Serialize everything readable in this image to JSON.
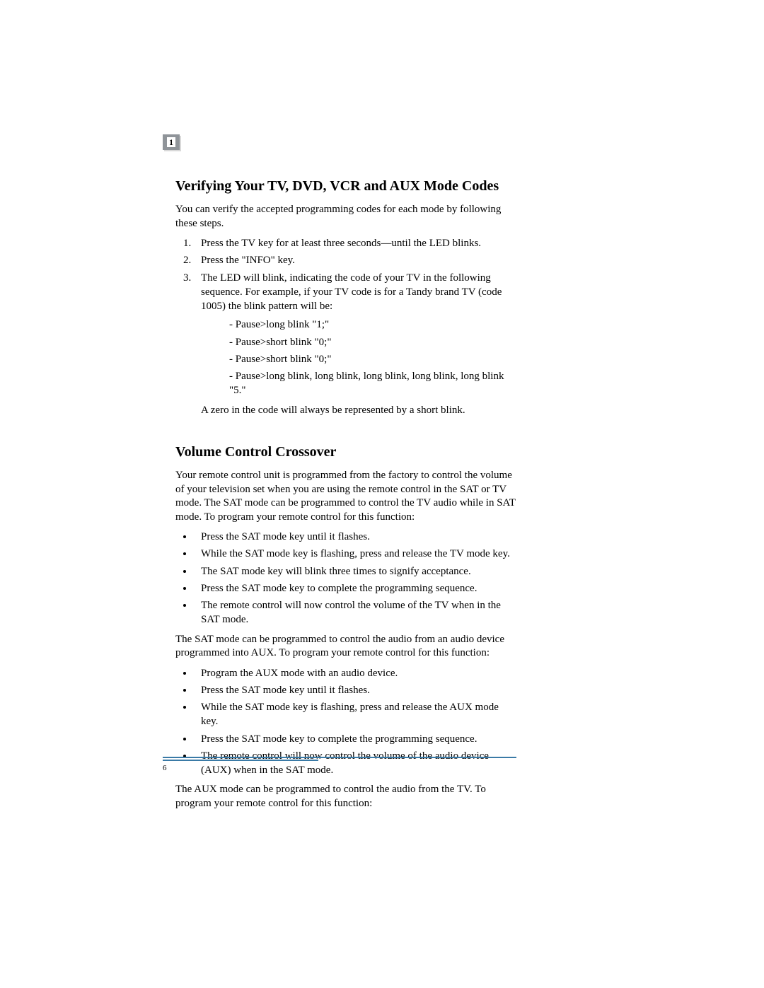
{
  "chapter_number": "1",
  "page_number": "6",
  "s1": {
    "heading": "Verifying Your TV, DVD, VCR and AUX Mode Codes",
    "intro": "You can verify the accepted programming codes for each mode by following these steps.",
    "steps": [
      "Press the TV key for at least three seconds—until the LED blinks.",
      "Press the \"INFO\" key.",
      "The LED will blink, indicating the code of your TV in the following sequence. For example, if your TV code is for a Tandy brand TV (code 1005) the blink pattern will be:"
    ],
    "sub": [
      "Pause>long blink \"1;\"",
      "Pause>short blink \"0;\"",
      "Pause>short blink \"0;\"",
      "Pause>long blink, long blink, long blink, long blink, long blink \"5.\""
    ],
    "note": "A zero in the code will always be represented by a short blink."
  },
  "s2": {
    "heading": "Volume Control Crossover",
    "p1": "Your remote control unit is programmed from the factory to control the volume of your television set when you are using the remote control in the SAT or TV mode. The SAT mode can be programmed to control the TV audio while in SAT mode. To program your remote control for this function:",
    "list1": [
      "Press the SAT mode key until it flashes.",
      "While the SAT mode key is flashing, press and release the TV mode key.",
      "The SAT mode key will blink three times to signify acceptance.",
      "Press the SAT mode key to complete the programming sequence.",
      "The remote control will now control the volume of the TV when in the SAT mode."
    ],
    "p2": "The SAT mode can be programmed to control the audio from an audio device programmed into AUX. To program your remote control for this function:",
    "list2": [
      "Program the AUX mode with an audio device.",
      "Press the SAT mode key until it flashes.",
      "While the SAT mode key is flashing, press and release the AUX mode key.",
      "Press the SAT mode key to complete the programming sequence.",
      "The remote control will now control the volume of the audio device (AUX) when in the SAT mode."
    ],
    "p3": "The AUX mode can be programmed to control the audio from the TV. To program your remote control for this function:"
  }
}
